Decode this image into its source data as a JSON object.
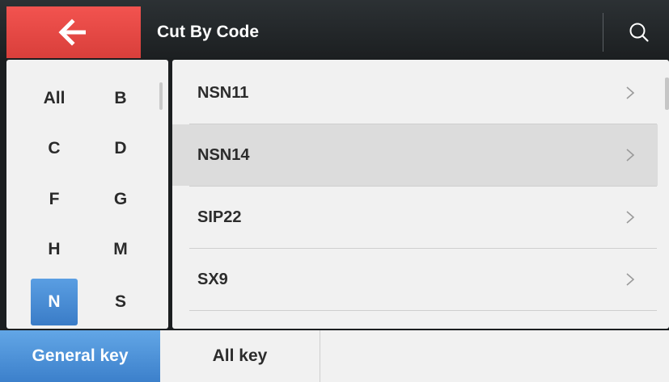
{
  "header": {
    "title": "Cut By Code",
    "back_icon": "arrow-left-icon",
    "search_icon": "search-icon"
  },
  "letters": [
    {
      "label": "All",
      "selected": false
    },
    {
      "label": "B",
      "selected": false
    },
    {
      "label": "C",
      "selected": false
    },
    {
      "label": "D",
      "selected": false
    },
    {
      "label": "F",
      "selected": false
    },
    {
      "label": "G",
      "selected": false
    },
    {
      "label": "H",
      "selected": false
    },
    {
      "label": "M",
      "selected": false
    },
    {
      "label": "N",
      "selected": true
    },
    {
      "label": "S",
      "selected": false
    }
  ],
  "list": {
    "items": [
      {
        "label": "NSN11",
        "selected": false
      },
      {
        "label": "NSN14",
        "selected": true
      },
      {
        "label": "SIP22",
        "selected": false
      },
      {
        "label": "SX9",
        "selected": false
      }
    ]
  },
  "tabs": [
    {
      "label": "General key",
      "active": true
    },
    {
      "label": "All key",
      "active": false
    }
  ],
  "colors": {
    "back_button": "#e84a46",
    "accent_blue": "#4a8fd6",
    "header_bg": "#23272a"
  }
}
